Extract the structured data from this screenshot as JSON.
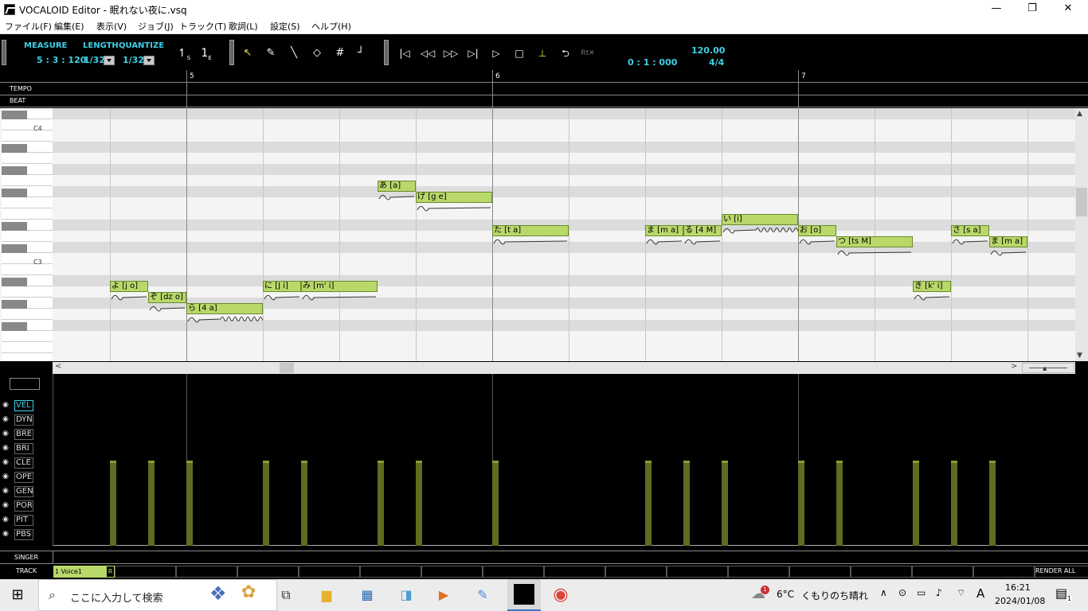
{
  "window": {
    "title": "VOCALOID Editor - 眠れない夜に.vsq",
    "minimize": "—",
    "maximize": "❐",
    "close": "✕"
  },
  "menu": [
    "ファイル(F)",
    "編集(E)",
    "表示(V)",
    "ジョブ(J)",
    "トラック(T)",
    "歌詞(L)",
    "設定(S)",
    "ヘルプ(H)"
  ],
  "toolbar": {
    "measure_label": "MEASURE",
    "measure_value": "5 : 3 : 120",
    "length_label": "LENGTH",
    "length_value": "1/32",
    "quantize_label": "QUANTIZE",
    "quantize_value": "1/32",
    "start_marker": "S",
    "end_marker": "E",
    "time_value": "0 : 1 : 000",
    "tempo_value": "120.00",
    "beat_value": "4/4"
  },
  "ruler": {
    "tempo_label": "TEMPO",
    "beat_label": "BEAT",
    "measures": [
      "5",
      "6",
      "7"
    ]
  },
  "keys": {
    "c4": "C4",
    "c3": "C3"
  },
  "notes": [
    {
      "lyric": "よ [j o]",
      "pitch": "D#3",
      "vib": false
    },
    {
      "lyric": "ぞ [dz o]",
      "pitch": "D3",
      "vib": false
    },
    {
      "lyric": "ら [4 a]",
      "pitch": "C#3",
      "vib": true
    },
    {
      "lyric": "に [J i]",
      "pitch": "D#3",
      "vib": false
    },
    {
      "lyric": "み [m' i]",
      "pitch": "D#3",
      "vib": false
    },
    {
      "lyric": "あ [a]",
      "pitch": "G#3",
      "vib": false
    },
    {
      "lyric": "げ [g e]",
      "pitch": "G3",
      "vib": false
    },
    {
      "lyric": "た [t a]",
      "pitch": "F3",
      "vib": false
    },
    {
      "lyric": "ま [m a]",
      "pitch": "F3",
      "vib": false
    },
    {
      "lyric": "る [4 M]",
      "pitch": "F3",
      "vib": false
    },
    {
      "lyric": "い [i]",
      "pitch": "F#3",
      "vib": true
    },
    {
      "lyric": "お [o]",
      "pitch": "F3",
      "vib": false
    },
    {
      "lyric": "つ [ts M]",
      "pitch": "E3",
      "vib": false
    },
    {
      "lyric": "き [k' i]",
      "pitch": "D#3",
      "vib": false
    },
    {
      "lyric": "さ [s a]",
      "pitch": "F3",
      "vib": false
    },
    {
      "lyric": "ま [m a]",
      "pitch": "E3",
      "vib": false
    }
  ],
  "control_tracks": [
    "VEL",
    "DYN",
    "BRE",
    "BRI",
    "CLE",
    "OPE",
    "GEN",
    "POR",
    "PIT",
    "PBS"
  ],
  "active_control": "VEL",
  "velocities": [
    64,
    64,
    64,
    64,
    64,
    64,
    64,
    64,
    64,
    64,
    64,
    64,
    64,
    64,
    64,
    64
  ],
  "bottom": {
    "singer_label": "SINGER",
    "track_label": "TRACK",
    "track_name": "1 Voice1",
    "render_mode": "R",
    "render_all": "RENDER ALL"
  },
  "taskbar": {
    "search_placeholder": "ここに入力して検索",
    "weather_temp": "6°C",
    "weather_text": "くもりのち晴れ",
    "weather_badge": "1",
    "ime": "A",
    "time": "16:21",
    "date": "2024/01/08",
    "notify_count": "1"
  }
}
